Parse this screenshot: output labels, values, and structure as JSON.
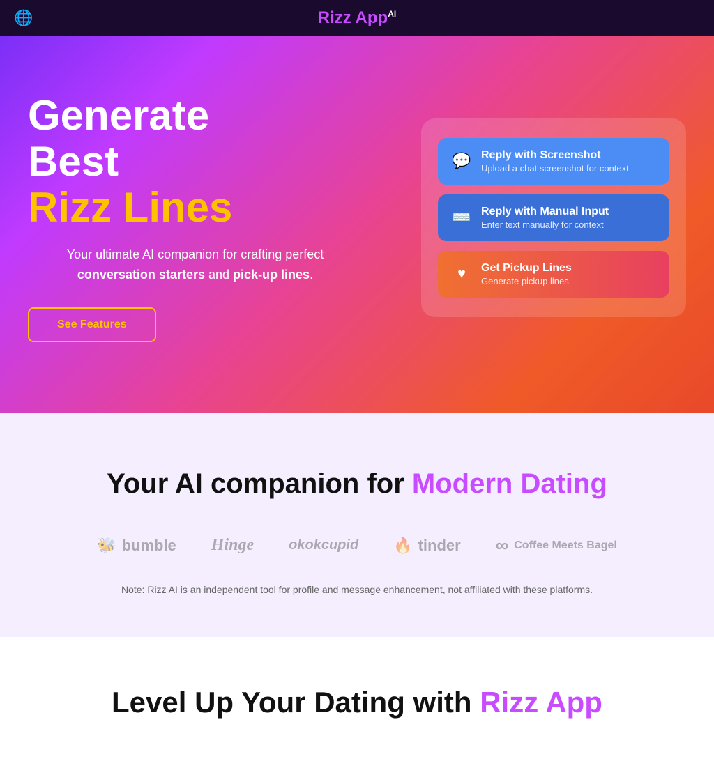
{
  "nav": {
    "globe_icon": "🌐",
    "title_purple": "Rizz App",
    "title_ai": "AI"
  },
  "hero": {
    "heading_line1": "Generate",
    "heading_line2": "Best",
    "heading_line3": "Rizz Lines",
    "description": "Your ultimate AI companion for crafting perfect",
    "description_bold1": "conversation starters",
    "description_and": "and",
    "description_bold2": "pick-up lines",
    "description_end": ".",
    "see_features_label": "See Features",
    "buttons": [
      {
        "id": "screenshot",
        "title": "Reply with Screenshot",
        "subtitle": "Upload a chat screenshot for context",
        "icon": "chat",
        "color": "blue"
      },
      {
        "id": "manual",
        "title": "Reply with Manual Input",
        "subtitle": "Enter text manually for context",
        "icon": "keyboard",
        "color": "blue-dark"
      },
      {
        "id": "pickup",
        "title": "Get Pickup Lines",
        "subtitle": "Generate pickup lines",
        "icon": "heart",
        "color": "orange"
      }
    ]
  },
  "platforms_section": {
    "heading_normal": "Your AI companion for",
    "heading_purple": "Modern Dating",
    "logos": [
      {
        "id": "bumble",
        "icon": "bee",
        "text": "bumble"
      },
      {
        "id": "hinge",
        "icon": "h",
        "text": "Hinge"
      },
      {
        "id": "okcupid",
        "icon": "ok",
        "text": "okcupid"
      },
      {
        "id": "tinder",
        "icon": "flame",
        "text": "tinder"
      },
      {
        "id": "cmb",
        "icon": "inf",
        "text": "Coffee Meets Bagel"
      }
    ],
    "note": "Note: Rizz AI is an independent tool for profile and message enhancement, not affiliated with these platforms."
  },
  "bottom_section": {
    "heading_normal": "Level Up Your Dating with",
    "heading_purple": "Rizz App"
  }
}
